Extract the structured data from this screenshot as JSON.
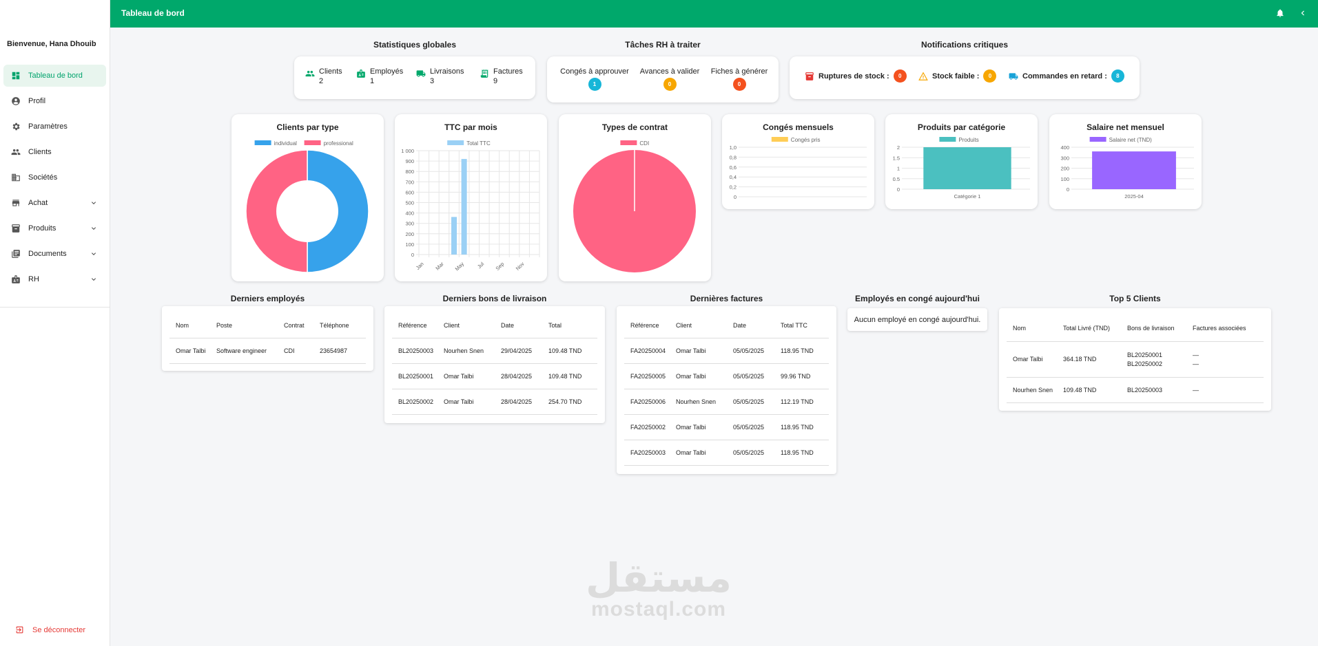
{
  "app": {
    "title": "Tableau de bord"
  },
  "sidebar": {
    "welcome": "Bienvenue, Hana Dhouib",
    "items": [
      {
        "label": "Tableau de bord",
        "icon": "dashboard-icon",
        "active": true
      },
      {
        "label": "Profil",
        "icon": "account-circle-icon"
      },
      {
        "label": "Paramètres",
        "icon": "gear-icon"
      },
      {
        "label": "Clients",
        "icon": "people-icon"
      },
      {
        "label": "Sociétés",
        "icon": "building-icon"
      },
      {
        "label": "Achat",
        "icon": "store-icon",
        "expandable": true
      },
      {
        "label": "Produits",
        "icon": "inventory-icon",
        "expandable": true
      },
      {
        "label": "Documents",
        "icon": "folder-icon",
        "expandable": true
      },
      {
        "label": "RH",
        "icon": "badge-icon",
        "expandable": true
      }
    ],
    "logout": "Se déconnecter"
  },
  "sections": {
    "stats_title": "Statistiques globales",
    "tasks_title": "Tâches RH à traiter",
    "notif_title": "Notifications critiques",
    "employees_title": "Derniers employés",
    "deliveries_title": "Derniers bons de livraison",
    "invoices_title": "Dernières factures",
    "leave_title": "Employés en congé aujourd'hui",
    "top_clients_title": "Top 5 Clients"
  },
  "stats": [
    {
      "label": "Clients",
      "value": "2",
      "icon": "people-icon"
    },
    {
      "label": "Employés",
      "value": "1",
      "icon": "badge-icon"
    },
    {
      "label": "Livraisons",
      "value": "3",
      "icon": "truck-icon"
    },
    {
      "label": "Factures",
      "value": "9",
      "icon": "receipt-icon"
    }
  ],
  "tasks": [
    {
      "label": "Congés à approuver",
      "value": "1",
      "color": "#17b6d8"
    },
    {
      "label": "Avances à valider",
      "value": "0",
      "color": "#f7a600"
    },
    {
      "label": "Fiches à générer",
      "value": "0",
      "color": "#f4511e"
    }
  ],
  "notifications": [
    {
      "label": "Ruptures de stock :",
      "value": "0",
      "icon": "archive-icon"
    },
    {
      "label": "Stock faible :",
      "value": "0",
      "icon": "warning-icon"
    },
    {
      "label": "Commandes en retard :",
      "value": "8",
      "icon": "truck-icon"
    }
  ],
  "colors": {
    "brand": "#00a86b",
    "blue": "#36a2eb",
    "pink": "#ff6384",
    "teal": "#4bc0c0",
    "purple": "#9966ff",
    "yellow": "#ffcd56",
    "lightblue": "#9ad0f5"
  },
  "chart_data": [
    {
      "type": "pie",
      "title": "Clients par type",
      "donut": true,
      "legend": "top",
      "categories": [
        "individual",
        "professional"
      ],
      "values": [
        1,
        1
      ],
      "colors": [
        "#36a2eb",
        "#ff6384"
      ]
    },
    {
      "type": "bar",
      "title": "TTC par mois",
      "legend": "top",
      "series": [
        {
          "name": "Total TTC",
          "values": [
            0,
            0,
            0,
            362,
            920,
            0,
            0,
            0,
            0,
            0,
            0,
            0
          ]
        }
      ],
      "categories": [
        "Jan",
        "Feb",
        "Mar",
        "Apr",
        "May",
        "Jun",
        "Jul",
        "Aug",
        "Sep",
        "Oct",
        "Nov",
        "Dec"
      ],
      "tick_labels_x": [
        "Jan",
        "Mar",
        "May",
        "Jul",
        "Sep",
        "Nov"
      ],
      "tick_labels_y": [
        "0",
        "100",
        "200",
        "300",
        "400",
        "500",
        "600",
        "700",
        "800",
        "900",
        "1 000"
      ],
      "ylim": [
        0,
        1000
      ],
      "grid": true
    },
    {
      "type": "pie",
      "title": "Types de contrat",
      "legend": "top",
      "categories": [
        "CDI"
      ],
      "values": [
        1
      ],
      "colors": [
        "#ff6384"
      ]
    },
    {
      "type": "bar",
      "title": "Congés mensuels",
      "legend": "top",
      "series": [
        {
          "name": "Congés pris",
          "values": []
        }
      ],
      "categories": [],
      "tick_labels_y": [
        "0",
        "0,2",
        "0,4",
        "0,6",
        "0,8",
        "1,0"
      ],
      "ylim": [
        0,
        1
      ]
    },
    {
      "type": "bar",
      "title": "Produits par catégorie",
      "legend": "top",
      "series": [
        {
          "name": "Produits",
          "values": [
            2
          ]
        }
      ],
      "categories": [
        "Catégorie 1"
      ],
      "tick_labels_y": [
        "0",
        "0.5",
        "1",
        "1.5",
        "2"
      ],
      "ylim": [
        0,
        2
      ]
    },
    {
      "type": "bar",
      "title": "Salaire net mensuel",
      "legend": "top",
      "series": [
        {
          "name": "Salaire net (TND)",
          "values": [
            360
          ]
        }
      ],
      "categories": [
        "2025-04"
      ],
      "tick_labels_y": [
        "0",
        "100",
        "200",
        "300",
        "400"
      ],
      "ylim": [
        0,
        400
      ]
    }
  ],
  "employees": {
    "headers": [
      "Nom",
      "Poste",
      "Contrat",
      "Téléphone"
    ],
    "rows": [
      [
        "Omar Talbi",
        "Software engineer",
        "CDI",
        "23654987"
      ]
    ]
  },
  "deliveries": {
    "headers": [
      "Référence",
      "Client",
      "Date",
      "Total"
    ],
    "rows": [
      [
        "BL20250003",
        "Nourhen Snen",
        "29/04/2025",
        "109.48 TND"
      ],
      [
        "BL20250001",
        "Omar Talbi",
        "28/04/2025",
        "109.48 TND"
      ],
      [
        "BL20250002",
        "Omar Talbi",
        "28/04/2025",
        "254.70 TND"
      ]
    ]
  },
  "invoices": {
    "headers": [
      "Référence",
      "Client",
      "Date",
      "Total TTC"
    ],
    "rows": [
      [
        "FA20250004",
        "Omar Talbi",
        "05/05/2025",
        "118.95 TND"
      ],
      [
        "FA20250005",
        "Omar Talbi",
        "05/05/2025",
        "99.96 TND"
      ],
      [
        "FA20250006",
        "Nourhen Snen",
        "05/05/2025",
        "112.19 TND"
      ],
      [
        "FA20250002",
        "Omar Talbi",
        "05/05/2025",
        "118.95 TND"
      ],
      [
        "FA20250003",
        "Omar Talbi",
        "05/05/2025",
        "118.95 TND"
      ]
    ]
  },
  "leave": {
    "empty_text": "Aucun employé en congé aujourd'hui."
  },
  "top_clients": {
    "headers": [
      "Nom",
      "Total Livré (TND)",
      "Bons de livraison",
      "Factures associées"
    ],
    "rows": [
      {
        "name": "Omar Talbi",
        "total": "364.18 TND",
        "bons": [
          "BL20250001",
          "BL20250002"
        ],
        "factures": [
          "—",
          "—"
        ]
      },
      {
        "name": "Nourhen Snen",
        "total": "109.48 TND",
        "bons": [
          "BL20250003"
        ],
        "factures": [
          "—"
        ]
      }
    ]
  },
  "watermark": {
    "arabic": "مستقل",
    "latin": "mostaql.com"
  }
}
